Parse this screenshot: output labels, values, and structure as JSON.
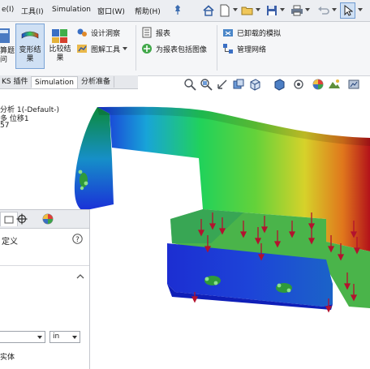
{
  "menubar": {
    "items": [
      {
        "label": "e(I)"
      },
      {
        "label": "工具(I)"
      },
      {
        "label": "Simulation"
      },
      {
        "label": "窗口(W)"
      },
      {
        "label": "帮助(H)"
      }
    ]
  },
  "ribbon": {
    "left_partial_label_1": "算题",
    "left_partial_label_2": "问",
    "deform_result": {
      "line1": "变形结",
      "line2": "果"
    },
    "compare_result": {
      "line1": "比较结",
      "line2": "果"
    },
    "design_insight": "设计洞察",
    "plot_tools": "图解工具",
    "report": "报表",
    "include_image": "为报表包括图像",
    "unloaded_sim": "已卸载的模拟",
    "manage_network": "管理网络"
  },
  "tabs": [
    {
      "label": "KS 插件"
    },
    {
      "label": "Simulation"
    },
    {
      "label": "分析准备"
    }
  ],
  "tree": {
    "line1": "分析 1(-Default-)",
    "line2": "多 位移1",
    "line3": "57"
  },
  "panel": {
    "title": "定义",
    "unit": "in",
    "bottom_label": "实体"
  },
  "colors": {
    "accent_selected": "#cfe0f4",
    "load_arrow": "#b3122e",
    "fixture": "#2f9a3a"
  }
}
